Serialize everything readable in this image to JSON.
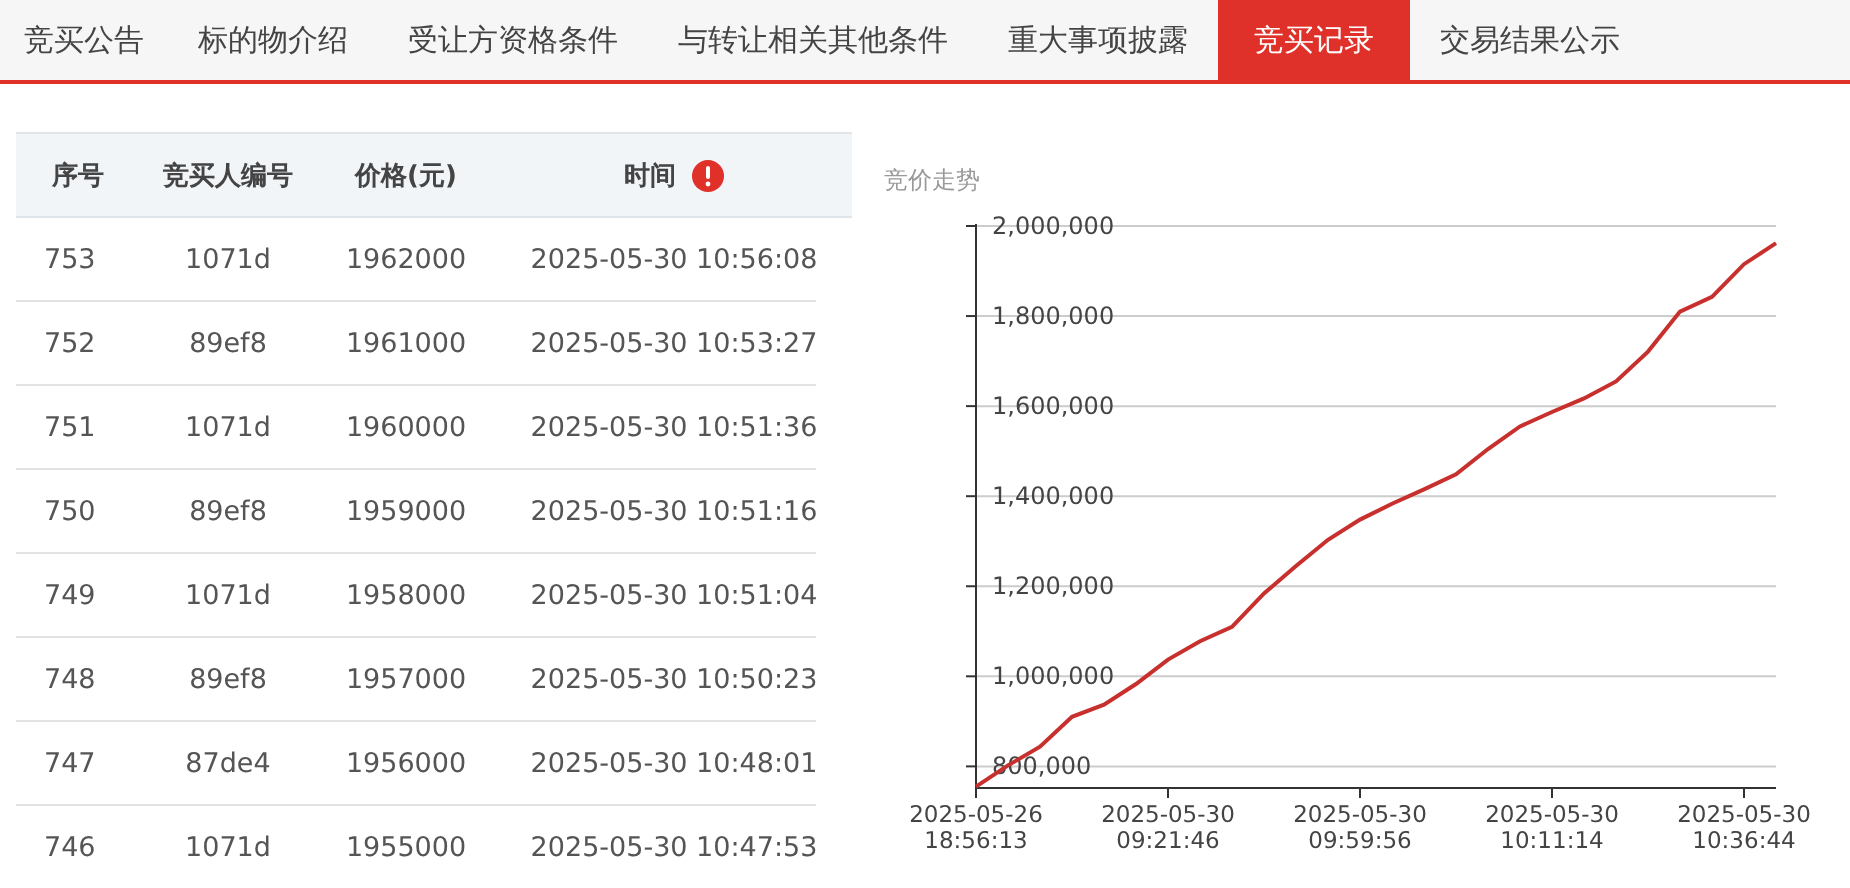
{
  "tabs": [
    {
      "label": "竞买公告",
      "selected": false
    },
    {
      "label": "标的物介绍",
      "selected": false
    },
    {
      "label": "受让方资格条件",
      "selected": false
    },
    {
      "label": "与转让相关其他条件",
      "selected": false
    },
    {
      "label": "重大事项披露",
      "selected": false
    },
    {
      "label": "竞买记录",
      "selected": true
    },
    {
      "label": "交易结果公示",
      "selected": false
    }
  ],
  "table": {
    "columns": [
      "序号",
      "竞买人编号",
      "价格(元)",
      "时间"
    ],
    "rows": [
      [
        "753",
        "1071d",
        "1962000",
        "2025-05-30 10:56:08"
      ],
      [
        "752",
        "89ef8",
        "1961000",
        "2025-05-30 10:53:27"
      ],
      [
        "751",
        "1071d",
        "1960000",
        "2025-05-30 10:51:36"
      ],
      [
        "750",
        "89ef8",
        "1959000",
        "2025-05-30 10:51:16"
      ],
      [
        "749",
        "1071d",
        "1958000",
        "2025-05-30 10:51:04"
      ],
      [
        "748",
        "89ef8",
        "1957000",
        "2025-05-30 10:50:23"
      ],
      [
        "747",
        "87de4",
        "1956000",
        "2025-05-30 10:48:01"
      ],
      [
        "746",
        "1071d",
        "1955000",
        "2025-05-30 10:47:53"
      ]
    ]
  },
  "chart": {
    "chart_data": {
      "type": "line",
      "title": "竞价走势",
      "categories": [
        "2025-05-26 18:56:13",
        null,
        null,
        null,
        null,
        null,
        "2025-05-30 09:21:46",
        null,
        null,
        null,
        null,
        null,
        "2025-05-30 09:59:56",
        null,
        null,
        null,
        null,
        null,
        "2025-05-30 10:11:14",
        null,
        null,
        null,
        null,
        null,
        "2025-05-30 10:36:44",
        null
      ],
      "series": [
        {
          "color": "#c8302e",
          "values": [
            755000,
            802000,
            844000,
            910000,
            937000,
            983000,
            1037000,
            1078000,
            1110000,
            1184000,
            1245000,
            1303000,
            1348000,
            1383000,
            1415000,
            1449000,
            1505000,
            1555000,
            1587000,
            1617000,
            1655000,
            1721000,
            1810000,
            1843000,
            1915000,
            1962000
          ]
        }
      ],
      "ylim": [
        752000,
        2000000
      ],
      "grid": true,
      "yticks": [
        {
          "value": 800000,
          "label": "800,000"
        },
        {
          "value": 1000000,
          "label": "1,000,000"
        },
        {
          "value": 1200000,
          "label": "1,200,000"
        },
        {
          "value": 1400000,
          "label": "1,400,000"
        },
        {
          "value": 1600000,
          "label": "1,600,000"
        },
        {
          "value": 1800000,
          "label": "1,800,000"
        },
        {
          "value": 2000000,
          "label": "2,000,000"
        }
      ]
    }
  }
}
